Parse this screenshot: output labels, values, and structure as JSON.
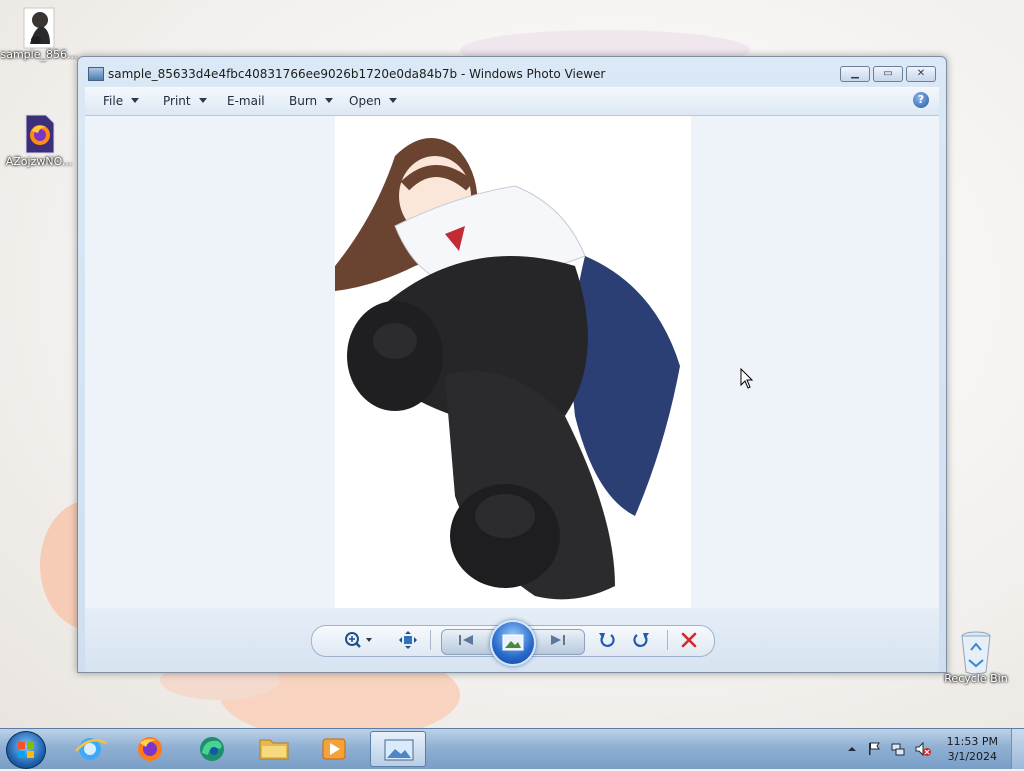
{
  "desktop": {
    "icons": [
      {
        "label": "sample_856..."
      },
      {
        "label": "AZojzwNO..."
      },
      {
        "label": "Recycle Bin"
      }
    ]
  },
  "window": {
    "title": "sample_85633d4e4fbc40831766ee9026b1720e0da84b7b - Windows Photo Viewer",
    "menu": [
      {
        "label": "File",
        "has_dropdown": true
      },
      {
        "label": "Print",
        "has_dropdown": true
      },
      {
        "label": "E-mail",
        "has_dropdown": false
      },
      {
        "label": "Burn",
        "has_dropdown": true
      },
      {
        "label": "Open",
        "has_dropdown": true
      }
    ],
    "help_label": "?"
  },
  "taskbar": {
    "clock_time": "11:53 PM",
    "clock_date": "3/1/2024"
  },
  "colors": {
    "accent": "#2668c9",
    "delete": "#d42a2a"
  }
}
